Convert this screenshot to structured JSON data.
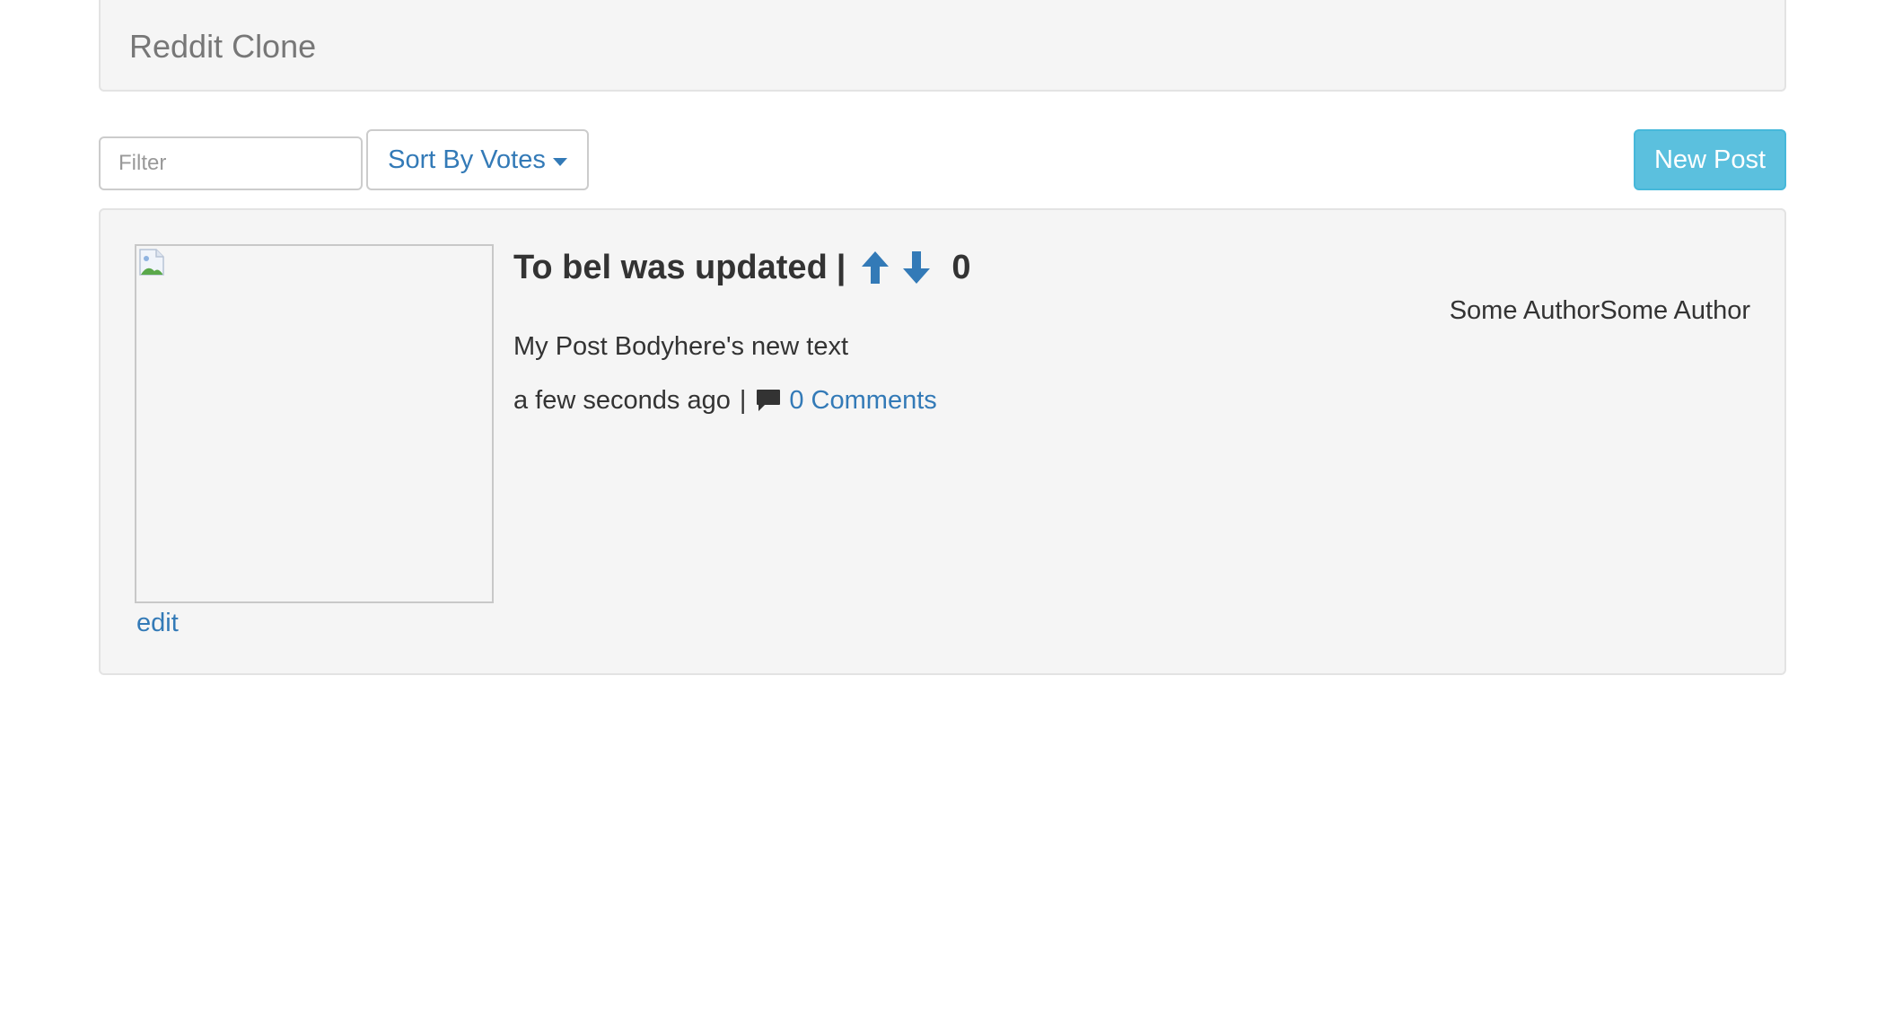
{
  "navbar": {
    "brand": "Reddit Clone"
  },
  "toolbar": {
    "filter_placeholder": "Filter",
    "filter_value": "",
    "sort_label": "Sort By Votes",
    "new_post_label": "New Post"
  },
  "post": {
    "title": "To bel was updated",
    "title_separator": "|",
    "vote_count": "0",
    "author": "Some AuthorSome Author",
    "body": "My Post Bodyhere's new text",
    "timestamp": "a few seconds ago",
    "meta_separator": "|",
    "comments_label": "0 Comments",
    "edit_label": "edit"
  },
  "colors": {
    "link": "#337ab7",
    "info_button": "#5bc0de",
    "panel_bg": "#f5f5f5"
  },
  "icons": {
    "upvote": "arrow-up-icon",
    "downvote": "arrow-down-icon",
    "comment": "comment-icon",
    "broken_image": "broken-image-icon"
  }
}
